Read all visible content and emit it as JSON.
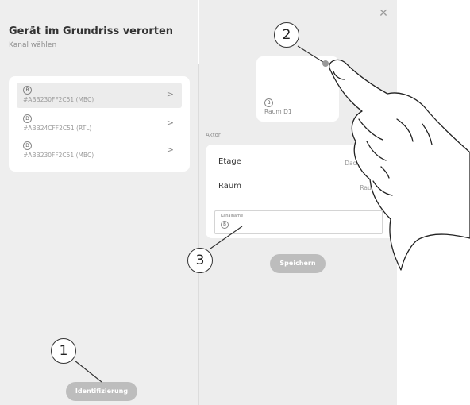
{
  "dialog": {
    "title": "Gerät im Grundriss verorten",
    "subtitle": "Kanal wählen",
    "close_icon": "close-icon"
  },
  "channels": [
    {
      "badge": "B",
      "id": "#ABB230FF2C51 (MBC)",
      "selected": true
    },
    {
      "badge": "D",
      "id": "#ABB24CFF2C51 (RTL)",
      "selected": false
    },
    {
      "badge": "D",
      "id": "#ABB230FF2C51 (MBC)",
      "selected": false
    }
  ],
  "room_card": {
    "badge": "B",
    "label": "Raum D1"
  },
  "aktor": {
    "section_label": "Aktor",
    "rows": [
      {
        "label": "Etage",
        "value": "Dachgeschoss"
      },
      {
        "label": "Raum",
        "value": "Raum D1"
      }
    ],
    "kanal_field": {
      "label": "Kanalname",
      "badge": "B"
    }
  },
  "buttons": {
    "save": "Speichern",
    "identify": "Identifizierung"
  },
  "callouts": [
    "1",
    "2",
    "3"
  ],
  "colors": {
    "panel": "#eeeeee",
    "card": "#ffffff",
    "button": "#bdbdbd"
  }
}
